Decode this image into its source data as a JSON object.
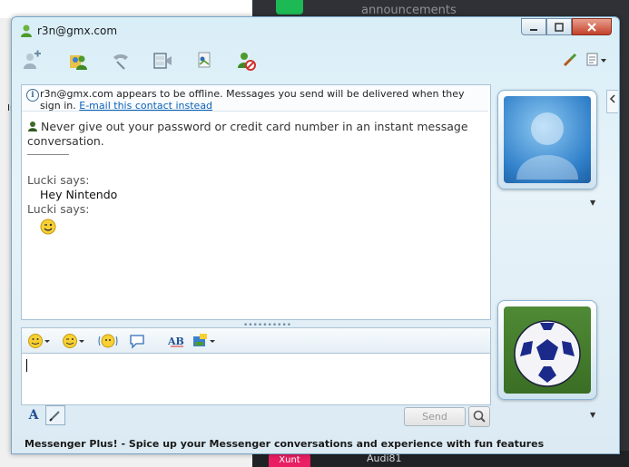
{
  "window": {
    "title": "r3n@gmx.com"
  },
  "info_bar": {
    "text": "r3n@gmx.com appears to be offline. Messages you send will be delivered when they sign in.",
    "link": "E-mail this contact instead"
  },
  "conversation": {
    "warning": "Never give out your password or credit card number in an instant message conversation.",
    "messages": [
      {
        "sender": "Lucki says:",
        "text": "Hey Nintendo"
      },
      {
        "sender": "Lucki says:",
        "emoticon": "wink-smiley-icon"
      }
    ]
  },
  "compose": {
    "send_label": "Send",
    "font_label": "A"
  },
  "status_bar": {
    "text": "Messenger Plus! - Spice up your Messenger conversations and experience with fun features"
  },
  "background": {
    "channel": "announcements",
    "bottom_name": "Audi81",
    "bottom_tag": "Xunt",
    "left_fragment": "In"
  },
  "colors": {
    "window_tint": "#dbeaf3",
    "link": "#0b61b8",
    "close_button": "#c4412a"
  }
}
